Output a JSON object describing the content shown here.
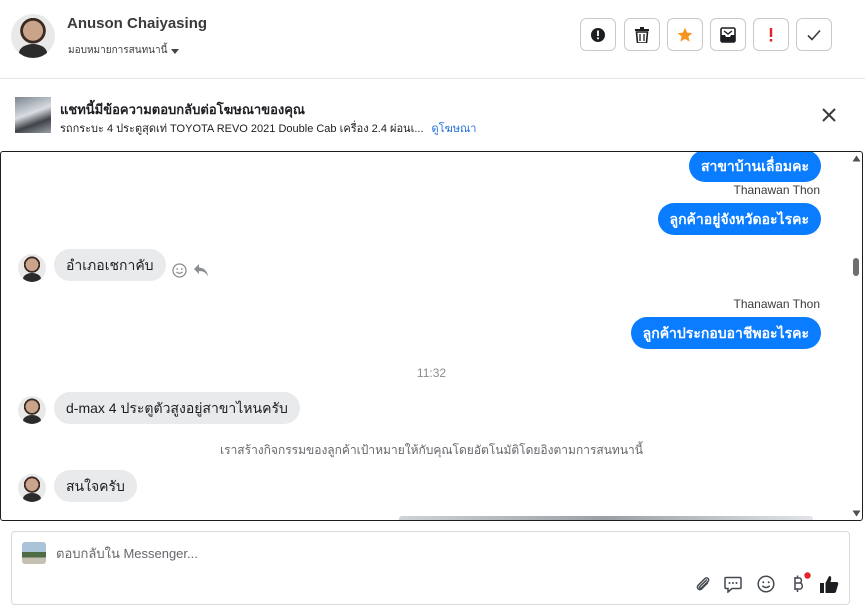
{
  "header": {
    "user_name": "Anuson Chaiyasing",
    "assign_label": "มอบหมายการสนทนานี้",
    "toolbar": [
      "info-icon",
      "trash-icon",
      "star-icon",
      "archive-icon",
      "exclamation-icon",
      "check-icon"
    ],
    "star_color": "#f7931e",
    "alert_color": "#e4232c"
  },
  "ad_banner": {
    "title": "แชทนี้มีข้อความตอบกลับต่อโฆษณาของคุณ",
    "subtitle": "รถกระบะ 4 ประตูสุดเท่ TOYOTA REVO 2021 Double Cab เครื่อง 2.4 ผ่อนเ...",
    "link": "ดูโฆษณา"
  },
  "conversation": {
    "messages": [
      {
        "side": "out",
        "text": "สาขาบ้านเลื่อมคะ"
      },
      {
        "side": "out",
        "sender": "Thanawan Thon",
        "text": "ลูกค้าอยู่จังหวัดอะไรคะ"
      },
      {
        "side": "in",
        "text": "อำเภอเชกาคับ"
      },
      {
        "side": "out",
        "sender": "Thanawan Thon",
        "text": "ลูกค้าประกอบอาชีพอะไรคะ"
      },
      {
        "side": "in",
        "text": "d-max 4 ประตูตัวสูงอยู่สาขาไหนครับ"
      },
      {
        "side": "in",
        "text": "สนใจครับ"
      }
    ],
    "timestamp": "11:32",
    "system_note": "เราสร้างกิจกรรมของลูกค้าเป้าหมายให้กับคุณโดยอัตโนมัติโดยอิงตามการสนทนานี้",
    "accent": "#0a7cff"
  },
  "composer": {
    "placeholder": "ตอบกลับใน Messenger...",
    "tools": [
      "attachment-icon",
      "chat-icon",
      "emoji-icon",
      "payment-icon",
      "like-icon"
    ]
  }
}
